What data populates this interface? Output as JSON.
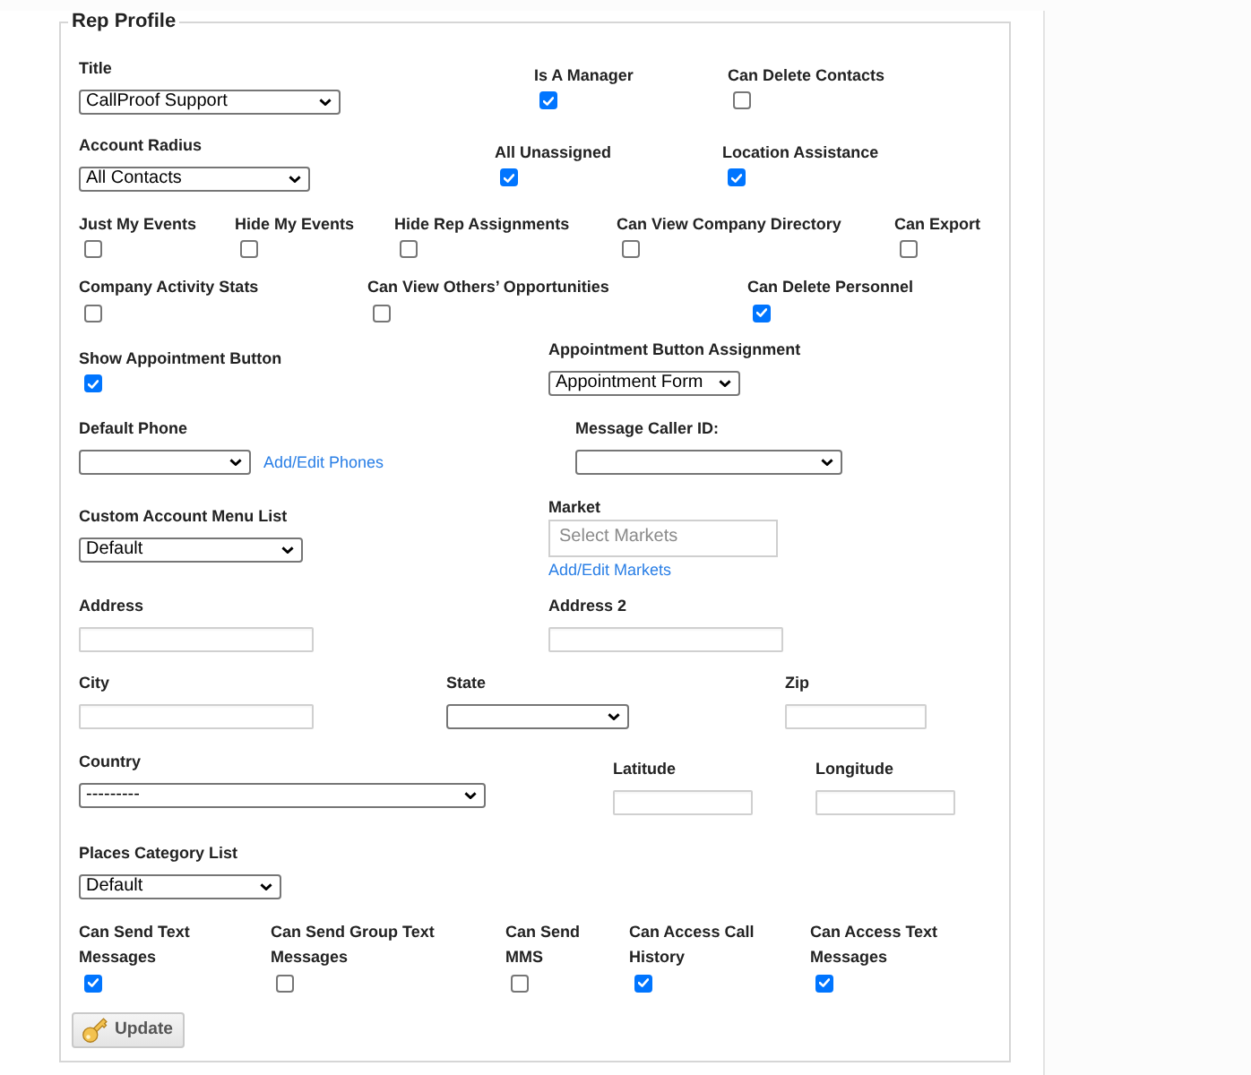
{
  "fieldset": {
    "legend": "Rep Profile"
  },
  "rows": [
    {
      "fields": [
        {
          "kind": "select",
          "label": "Title",
          "value": "CallProof Support"
        },
        {
          "kind": "checkbox",
          "label": "Is A Manager",
          "checked": true
        },
        {
          "kind": "checkbox",
          "label": "Can Delete Contacts",
          "checked": false
        }
      ]
    },
    {
      "fields": [
        {
          "kind": "select",
          "label": "Account Radius",
          "value": "All Contacts"
        },
        {
          "kind": "checkbox",
          "label": "All Unassigned",
          "checked": true
        },
        {
          "kind": "checkbox",
          "label": "Location Assistance",
          "checked": true
        }
      ]
    },
    {
      "fields": [
        {
          "kind": "checkbox",
          "label": "Just My Events",
          "checked": false
        },
        {
          "kind": "checkbox",
          "label": "Hide My Events",
          "checked": false
        },
        {
          "kind": "checkbox",
          "label": "Hide Rep Assignments",
          "checked": false
        },
        {
          "kind": "checkbox",
          "label": "Can View Company Directory",
          "checked": false
        },
        {
          "kind": "checkbox",
          "label": "Can Export",
          "checked": false
        }
      ]
    },
    {
      "fields": [
        {
          "kind": "checkbox",
          "label": "Company Activity Stats",
          "checked": false
        },
        {
          "kind": "checkbox",
          "label": "Can View Others’ Opportunities",
          "checked": false
        },
        {
          "kind": "checkbox",
          "label": "Can Delete Personnel",
          "checked": true
        }
      ]
    },
    {
      "fields": [
        {
          "kind": "checkbox",
          "label": "Show Appointment Button",
          "checked": true
        },
        {
          "kind": "select",
          "label": "Appointment Button Assignment",
          "value": "Appointment Form"
        }
      ]
    },
    {
      "fields": [
        {
          "kind": "select",
          "label": "Default Phone",
          "link": "Add/Edit Phones"
        },
        {
          "kind": "select",
          "label": "Message Caller ID:"
        }
      ]
    },
    {
      "fields": [
        {
          "kind": "select",
          "label": "Custom Account Menu List",
          "value": "Default"
        },
        {
          "kind": "multiselect",
          "label": "Market",
          "placeholder": "Select Markets",
          "link": "Add/Edit Markets"
        }
      ]
    },
    {
      "fields": [
        {
          "kind": "text",
          "label": "Address"
        },
        {
          "kind": "text",
          "label": "Address 2"
        }
      ]
    },
    {
      "fields": [
        {
          "kind": "text",
          "label": "City"
        },
        {
          "kind": "select",
          "label": "State"
        },
        {
          "kind": "text",
          "label": "Zip"
        }
      ]
    },
    {
      "fields": [
        {
          "kind": "select",
          "label": "Country",
          "value": "---------"
        },
        {
          "kind": "text",
          "label": "Latitude"
        },
        {
          "kind": "text",
          "label": "Longitude"
        }
      ]
    },
    {
      "fields": [
        {
          "kind": "select",
          "label": "Places Category List",
          "value": "Default"
        }
      ]
    },
    {
      "fields": [
        {
          "kind": "checkbox",
          "label": "Can Send Text Messages",
          "checked": true
        },
        {
          "kind": "checkbox",
          "label": "Can Send Group Text Messages",
          "checked": false
        },
        {
          "kind": "checkbox",
          "label": "Can Send MMS",
          "checked": false
        },
        {
          "kind": "checkbox",
          "label": "Can Access Call History",
          "checked": true
        },
        {
          "kind": "checkbox",
          "label": "Can Access Text Messages",
          "checked": true
        }
      ]
    }
  ],
  "update_button": {
    "label": "Update"
  }
}
